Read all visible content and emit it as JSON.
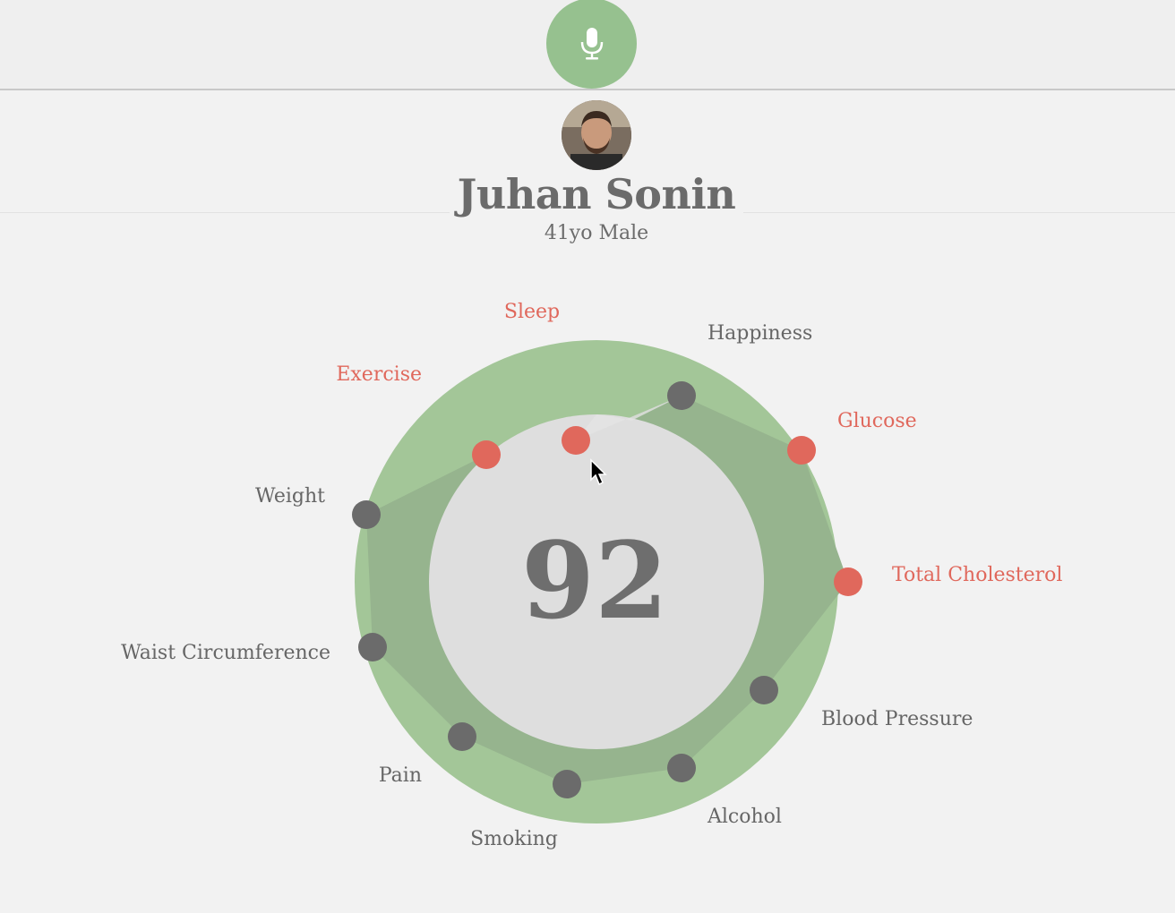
{
  "profile": {
    "name": "Juhan Sonin",
    "subtitle": "41yo Male"
  },
  "icons": {
    "mic": "microphone-icon",
    "cursor": "mouse-pointer-icon"
  },
  "colors": {
    "green_ring": "#a3c698",
    "green_poly": "#96b48e",
    "center": "#dedede",
    "dot_normal": "#6b6b6b",
    "dot_alert": "#e0685c",
    "label_normal": "#666666",
    "label_alert": "#e0685c",
    "background": "#f2f2f2"
  },
  "score": "92",
  "metrics": [
    {
      "label": "Sleep",
      "alert": true
    },
    {
      "label": "Happiness",
      "alert": false
    },
    {
      "label": "Glucose",
      "alert": true
    },
    {
      "label": "Total Cholesterol",
      "alert": true
    },
    {
      "label": "Blood Pressure",
      "alert": false
    },
    {
      "label": "Alcohol",
      "alert": false
    },
    {
      "label": "Smoking",
      "alert": false
    },
    {
      "label": "Pain",
      "alert": false
    },
    {
      "label": "Waist Circumference",
      "alert": false
    },
    {
      "label": "Weight",
      "alert": false
    },
    {
      "label": "Exercise",
      "alert": true
    }
  ]
}
